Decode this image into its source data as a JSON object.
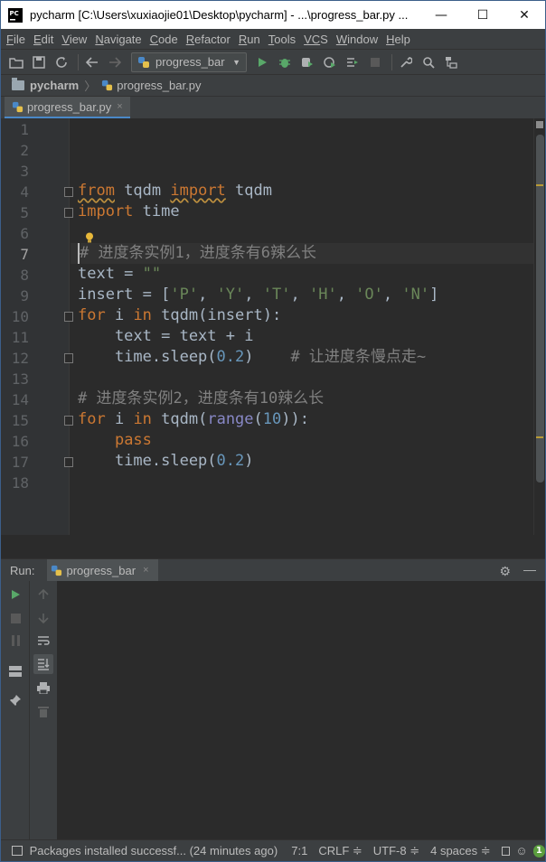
{
  "window": {
    "title": "pycharm [C:\\Users\\xuxiaojie01\\Desktop\\pycharm] - ...\\progress_bar.py ...",
    "min_glyph": "—",
    "max_glyph": "☐",
    "close_glyph": "✕"
  },
  "menu": [
    {
      "u": "F",
      "rest": "ile"
    },
    {
      "u": "E",
      "rest": "dit"
    },
    {
      "u": "V",
      "rest": "iew"
    },
    {
      "u": "N",
      "rest": "avigate"
    },
    {
      "u": "C",
      "rest": "ode"
    },
    {
      "u": "R",
      "rest": "efactor"
    },
    {
      "u": "R",
      "rest": "un"
    },
    {
      "u": "T",
      "rest": "ools"
    },
    {
      "u": "VC",
      "rest": "S"
    },
    {
      "u": "W",
      "rest": "indow"
    },
    {
      "u": "H",
      "rest": "elp"
    }
  ],
  "toolbar": {
    "run_config": "progress_bar"
  },
  "breadcrumb": {
    "project": "pycharm",
    "file": "progress_bar.py"
  },
  "editor_tab": {
    "label": "progress_bar.py",
    "close": "×"
  },
  "editor": {
    "current_line": 7,
    "line_numbers": [
      "1",
      "2",
      "3",
      "4",
      "5",
      "6",
      "7",
      "8",
      "9",
      "10",
      "11",
      "12",
      "13",
      "14",
      "15",
      "16",
      "17",
      "18"
    ],
    "lines": {
      "l4": {
        "a": "from",
        "b": " tqdm ",
        "c": "import",
        "d": " tqdm"
      },
      "l5": {
        "a": "import",
        "b": " time"
      },
      "l7": {
        "a": "# 进度条实例1，进度条有6辣么长"
      },
      "l8": {
        "a": "text = ",
        "b": "\"\""
      },
      "l9": {
        "a": "insert = [",
        "b": "'P'",
        "c": ", ",
        "d": "'Y'",
        "e": ", ",
        "f": "'T'",
        "g": ", ",
        "h": "'H'",
        "i": ", ",
        "j": "'O'",
        "k": ", ",
        "l": "'N'",
        "m": "]"
      },
      "l10": {
        "a": "for",
        "b": " i ",
        "c": "in",
        "d": " tqdm(insert):"
      },
      "l11": {
        "a": "    text = text + i"
      },
      "l12": {
        "a": "    time.sleep(",
        "b": "0.2",
        "c": ")    ",
        "d": "# 让进度条慢点走~"
      },
      "l14": {
        "a": "# 进度条实例2，进度条有10辣么长"
      },
      "l15": {
        "a": "for",
        "b": " i ",
        "c": "in",
        "d": " tqdm(",
        "e": "range",
        "f": "(",
        "g": "10",
        "h": ")):"
      },
      "l16": {
        "a": "    ",
        "b": "pass"
      },
      "l17": {
        "a": "    time.sleep(",
        "b": "0.2",
        "c": ")"
      }
    }
  },
  "run_panel": {
    "label": "Run:",
    "tab": "progress_bar",
    "close": "×"
  },
  "statusbar": {
    "message": "Packages installed successf... (24 minutes ago)",
    "position": "7:1",
    "line_sep": "CRLF ≑",
    "encoding": "UTF-8 ≑",
    "indent": "4 spaces ≑",
    "badge": "1"
  },
  "colors": {
    "keyword": "#cc7832",
    "number": "#6897bb",
    "string": "#6a8759",
    "comment": "#808080",
    "builtin": "#8888c6",
    "run_green": "#59a869"
  }
}
